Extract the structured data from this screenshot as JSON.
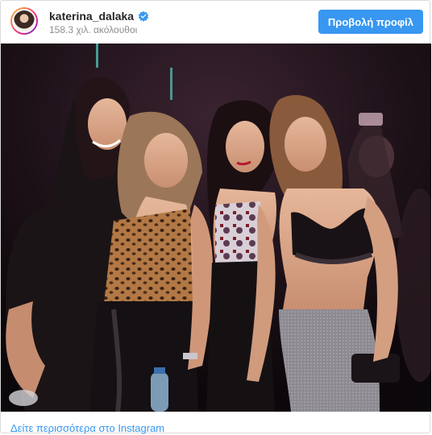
{
  "post": {
    "username": "katerina_dalaka",
    "followers": "158.3 χιλ. ακόλουθοι",
    "profile_button": "Προβολή προφίλ",
    "see_more": "Δείτε περισσότερα στο Instagram"
  },
  "colors": {
    "accent": "#3897f0",
    "verified": "#3897f0",
    "photo_background": "#120a10"
  },
  "icons": {
    "verified": "verified-badge-icon"
  }
}
